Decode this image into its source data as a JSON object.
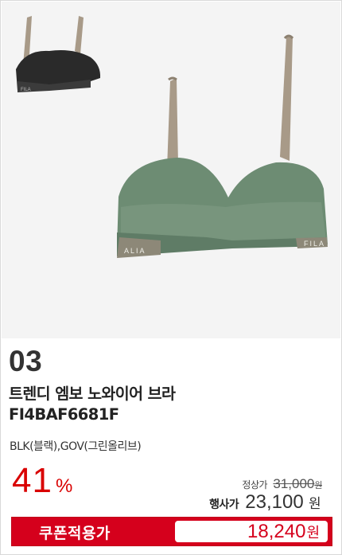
{
  "product": {
    "number": "03",
    "name_line1": "트렌디 엠보 노와이어 브라",
    "name_line2": "FI4BAF6681F",
    "colors": "BLK(블랙),GOV(그린올리브)",
    "image_alt": "bra product image",
    "brand_band_text": "FILA"
  },
  "pricing": {
    "discount_value": "41",
    "discount_unit": "%",
    "regular_label": "정상가",
    "regular_price": "31,000",
    "regular_unit": "원",
    "event_label": "행사가",
    "event_price": "23,100",
    "event_unit": "원",
    "coupon_label": "쿠폰적용가",
    "coupon_price": "18,240",
    "coupon_unit": "원"
  },
  "colors": {
    "accent_red": "#d5001c",
    "discount_red": "#d90000",
    "bra_green": "#6d8c73",
    "bra_black": "#2a2a2a",
    "strap_beige": "#a89a88"
  }
}
